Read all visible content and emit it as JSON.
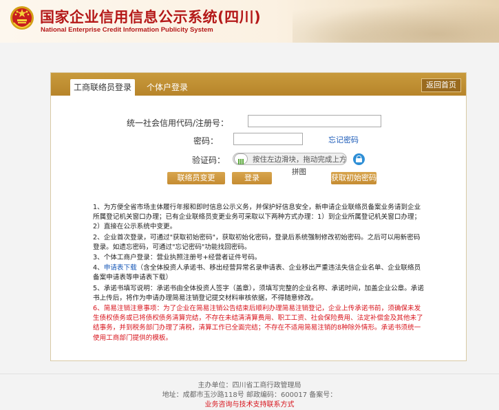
{
  "header": {
    "title": "国家企业信用信息公示系统(四川)",
    "subtitle": "National Enterprise Credit Information Publicity System",
    "brand_color": "#b41818"
  },
  "tabs": [
    {
      "label": "工商联络员登录",
      "active": true
    },
    {
      "label": "个体户登录",
      "active": false
    }
  ],
  "home_button": "返回首页",
  "form": {
    "code_label": "统一社会信用代码/注册号：",
    "code_value": "",
    "password_label": "密码：",
    "password_value": "",
    "forgot_link": "忘记密码",
    "captcha_label": "验证码：",
    "slider_hint": "按住左边滑块，拖动完成上方",
    "puzzle_text": "拼图",
    "btn_change": "联络员变更",
    "btn_login": "登录",
    "btn_initial": "获取初始密码"
  },
  "notes": {
    "n1": "1、为方便全省市场主体履行年报和即时信息公示义务，并保护好信息安全，新申请企业联络员备案业务请到企业所属登记机关窗口办理；已有企业联络员变更业务可采取以下两种方式办理：1）到企业所属登记机关窗口办理；2）直接在公示系统中变更。",
    "n2": "2、企业首次登录，可通过\"获取初始密码\"，获取初始化密码，登录后系统强制修改初始密码。之后可以用新密码登录。如遗忘密码，可通过\"忘记密码\"功能找回密码。",
    "n3": "3、个体工商户登录：营业执照注册号+经营者证件号码。",
    "n4_prefix": "4、",
    "n4_link": "申请表下载",
    "n4_rest": "（含全体投资人承诺书、移出经营异常名录申请表、企业移出严重违法失信企业名单、企业联络员备案申请表等申请表下载）",
    "n5": "5、承诺书填写说明：承诺书由全体投资人签字（盖章），须填写完整的企业名称、承诺时间，加盖企业公章。承诺书上传后，将作为申请办理简易注销登记提交材料审核依据，不得随意修改。",
    "n6": "6、简易注销注意事项：为了企业在简易注销公告结束后顺利办理简易注销登记，企业上传承诺书前，须确保未发生债权债务或已将债权债务清算完结，不存在未结清清算费用、职工工资、社会保险费用、法定补偿金及其他未了结事务，并到税务部门办理了清税，清算工作已全面完结；不存在不适用简易注销的8种除外情形。承诺书须统一使用工商部门提供的模板。"
  },
  "footer": {
    "host": "主办单位：四川省工商行政管理局",
    "address": "地址：成都市玉沙路118号  邮政编码：600017  备案号：",
    "support_link": "业务咨询与技术支持联系方式"
  }
}
